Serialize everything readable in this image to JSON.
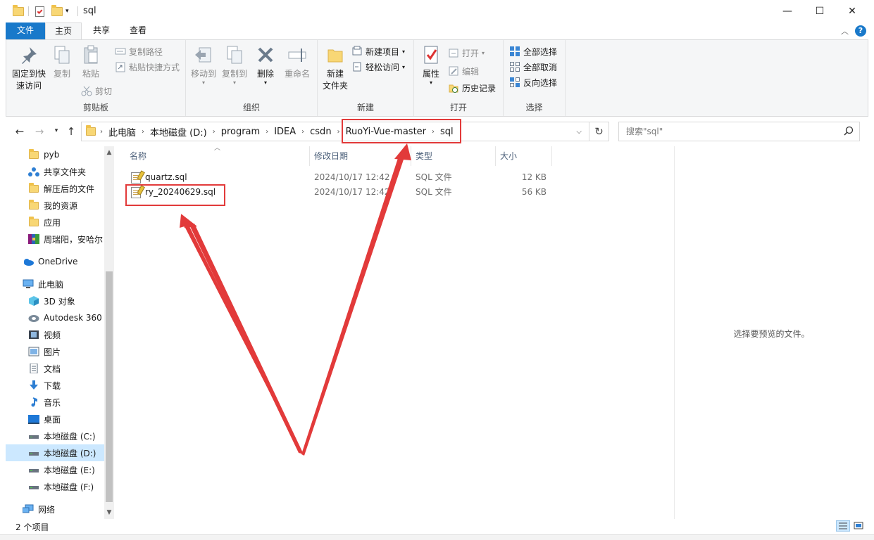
{
  "window": {
    "title": "sql",
    "minimize": "—",
    "maximize": "☐",
    "close": "✕"
  },
  "ribbon_tabs": [
    "文件",
    "主页",
    "共享",
    "查看"
  ],
  "ribbon": {
    "clipboard": {
      "pin": [
        "固定到快",
        "速访问"
      ],
      "copy": "复制",
      "paste": "粘贴",
      "copy_path": "复制路径",
      "paste_shortcut": "粘贴快捷方式",
      "cut": "剪切",
      "label": "剪贴板"
    },
    "organize": {
      "move_to": "移动到",
      "copy_to": "复制到",
      "delete": "删除",
      "rename": "重命名",
      "label": "组织"
    },
    "new": {
      "new_folder": [
        "新建",
        "文件夹"
      ],
      "new_item": "新建项目",
      "easy_access": "轻松访问",
      "label": "新建"
    },
    "open": {
      "properties": "属性",
      "open": "打开",
      "edit": "编辑",
      "history": "历史记录",
      "label": "打开"
    },
    "select": {
      "select_all": "全部选择",
      "select_none": "全部取消",
      "invert": "反向选择",
      "label": "选择"
    }
  },
  "address": {
    "crumbs": [
      "此电脑",
      "本地磁盘 (D:)",
      "program",
      "IDEA",
      "csdn",
      "RuoYi-Vue-master",
      "sql"
    ]
  },
  "search": {
    "placeholder": "搜索\"sql\""
  },
  "sidebar": {
    "items": [
      {
        "label": "pyb",
        "icon": "folder-icon"
      },
      {
        "label": "共享文件夹",
        "icon": "shared-folder-icon"
      },
      {
        "label": "解压后的文件",
        "icon": "folder-icon"
      },
      {
        "label": "我的资源",
        "icon": "folder-icon"
      },
      {
        "label": "应用",
        "icon": "folder-icon"
      },
      {
        "label": "周瑞阳，安哈尔",
        "icon": "archive-icon"
      },
      {
        "label": "OneDrive",
        "icon": "cloud-icon"
      },
      {
        "label": "此电脑",
        "icon": "computer-icon"
      },
      {
        "label": "3D 对象",
        "icon": "cube-icon"
      },
      {
        "label": "Autodesk 360",
        "icon": "autodesk-icon"
      },
      {
        "label": "视频",
        "icon": "video-icon"
      },
      {
        "label": "图片",
        "icon": "picture-icon"
      },
      {
        "label": "文档",
        "icon": "document-icon"
      },
      {
        "label": "下载",
        "icon": "download-icon"
      },
      {
        "label": "音乐",
        "icon": "music-icon"
      },
      {
        "label": "桌面",
        "icon": "desktop-icon"
      },
      {
        "label": "本地磁盘 (C:)",
        "icon": "drive-icon"
      },
      {
        "label": "本地磁盘 (D:)",
        "icon": "drive-icon"
      },
      {
        "label": "本地磁盘 (E:)",
        "icon": "drive-icon"
      },
      {
        "label": "本地磁盘 (F:)",
        "icon": "drive-icon"
      },
      {
        "label": "网络",
        "icon": "network-icon"
      }
    ]
  },
  "columns": [
    "名称",
    "修改日期",
    "类型",
    "大小"
  ],
  "files": [
    {
      "name": "quartz.sql",
      "modified": "2024/10/17 12:42",
      "type": "SQL 文件",
      "size": "12 KB"
    },
    {
      "name": "ry_20240629.sql",
      "modified": "2024/10/17 12:42",
      "type": "SQL 文件",
      "size": "56 KB"
    }
  ],
  "preview": {
    "message": "选择要预览的文件。"
  },
  "status": {
    "item_count": "2 个项目"
  },
  "colors": {
    "accent": "#1979ca",
    "selection": "#cce8ff",
    "annotation": "#e23a3a",
    "folder": "#f8d775"
  }
}
